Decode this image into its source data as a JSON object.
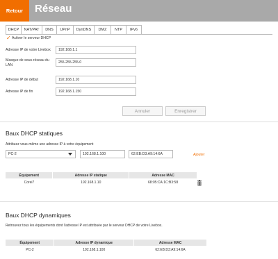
{
  "header": {
    "back_label": "Retour",
    "title": "Réseau"
  },
  "tabs": [
    {
      "label": "DHCP",
      "active": true
    },
    {
      "label": "NAT/PAT",
      "active": false
    },
    {
      "label": "DNS",
      "active": false
    },
    {
      "label": "UPnP",
      "active": false
    },
    {
      "label": "DynDNS",
      "active": false
    },
    {
      "label": "DMZ",
      "active": false
    },
    {
      "label": "NTP",
      "active": false
    },
    {
      "label": "IPv6",
      "active": false
    }
  ],
  "dhcp": {
    "enable_label": "Activer le serveur DHCP",
    "enabled": true,
    "fields": [
      {
        "label": "Adresse IP de votre Livebox",
        "value": "192.168.1.1"
      },
      {
        "label": "Masque de sous-réseau du LAN",
        "value": "255.255.255.0"
      },
      {
        "label": "Adresse IP de début",
        "value": "192.168.1.10"
      },
      {
        "label": "Adresse IP de fin",
        "value": "192.168.1.150"
      }
    ],
    "cancel_label": "Annuler",
    "save_label": "Enregistrer"
  },
  "static": {
    "title": "Baux DHCP statiques",
    "desc": "Attribuez vous-même une adresse IP à votre équipement",
    "device_select": "PC-2",
    "ip_value": "192.168.1.100",
    "mac_value": "62:EB:D3:A9:14:6A",
    "add_label": "Ajouter",
    "columns": [
      "Équipement",
      "Adresse IP statique",
      "Adresse MAC"
    ],
    "rows": [
      [
        "Corei7",
        "192.168.1.10",
        "68:05:CA:1C:B3:58"
      ]
    ]
  },
  "dynamic": {
    "title": "Baux DHCP dynamiques",
    "desc": "Retrouvez tous les équipements dont l'adresse IP est attribuée par le serveur DHCP de votre Livebox.",
    "columns": [
      "Équipement",
      "Adresse IP dynamique",
      "Adresse MAC"
    ],
    "rows": [
      [
        "PC-2",
        "192.168.1.100",
        "62:EB:D3:A9:14:6A"
      ]
    ]
  },
  "colors": {
    "brand_orange": "#f16e00",
    "header_gray": "#a9a9a9"
  }
}
